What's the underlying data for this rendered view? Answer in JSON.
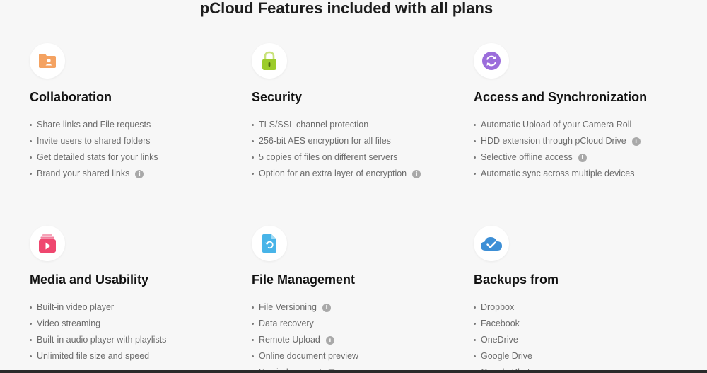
{
  "page": {
    "title": "pCloud Features included with all plans"
  },
  "features": [
    {
      "title": "Collaboration",
      "icon": "folder-user-icon",
      "items": [
        {
          "text": "Share links and File requests",
          "info": false
        },
        {
          "text": "Invite users to shared folders",
          "info": false
        },
        {
          "text": "Get detailed stats for your links",
          "info": false
        },
        {
          "text": "Brand your shared links",
          "info": true
        }
      ]
    },
    {
      "title": "Security",
      "icon": "lock-icon",
      "items": [
        {
          "text": "TLS/SSL channel protection",
          "info": false
        },
        {
          "text": "256-bit AES encryption for all files",
          "info": false
        },
        {
          "text": "5 copies of files on different servers",
          "info": false
        },
        {
          "text": "Option for an extra layer of encryption",
          "info": true
        }
      ]
    },
    {
      "title": "Access and Synchronization",
      "icon": "sync-icon",
      "items": [
        {
          "text": "Automatic Upload of your Camera Roll",
          "info": false
        },
        {
          "text": "HDD extension through pCloud Drive",
          "info": true
        },
        {
          "text": "Selective offline access",
          "info": true
        },
        {
          "text": "Automatic sync across multiple devices",
          "info": false
        }
      ]
    },
    {
      "title": "Media and Usability",
      "icon": "media-play-icon",
      "items": [
        {
          "text": "Built-in video player",
          "info": false
        },
        {
          "text": "Video streaming",
          "info": false
        },
        {
          "text": "Built-in audio player with playlists",
          "info": false
        },
        {
          "text": "Unlimited file size and speed",
          "info": false
        }
      ]
    },
    {
      "title": "File Management",
      "icon": "file-restore-icon",
      "items": [
        {
          "text": "File Versioning",
          "info": true
        },
        {
          "text": "Data recovery",
          "info": false
        },
        {
          "text": "Remote Upload",
          "info": true
        },
        {
          "text": "Online document preview",
          "info": false
        },
        {
          "text": "Rewind account",
          "info": true
        }
      ]
    },
    {
      "title": "Backups from",
      "icon": "cloud-check-icon",
      "items": [
        {
          "text": "Dropbox",
          "info": false
        },
        {
          "text": "Facebook",
          "info": false
        },
        {
          "text": "OneDrive",
          "info": false
        },
        {
          "text": "Google Drive",
          "info": false
        },
        {
          "text": "Google Photos",
          "info": false
        }
      ]
    }
  ],
  "info_glyph": "i",
  "colors": {
    "collaboration": "#f4a261",
    "security": "#9ccc2b",
    "sync": "#9b6ddb",
    "media": "#ef476f",
    "file": "#48b4e8",
    "cloud": "#3d8fd6"
  }
}
